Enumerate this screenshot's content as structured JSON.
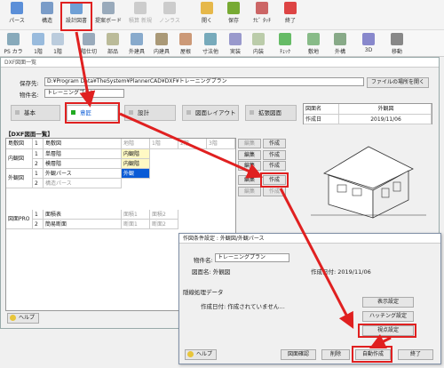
{
  "toolbar1": [
    "パース",
    "構造",
    "設計図書",
    "提案ボード",
    "積算 新規",
    "ノンラス",
    "開く",
    "保存",
    "ﾅﾋﾞ ﾀｯﾁ",
    "終了"
  ],
  "toolbar2": [
    "PS カラー",
    "1階",
    "1階",
    "階仕切",
    "部品",
    "外建具",
    "内建具",
    "屋根",
    "寸法他",
    "実装",
    "内装",
    "ﾁｪｯｸ",
    "敷地",
    "外構",
    "3D",
    "移動"
  ],
  "win": {
    "title": "DXF図面一覧",
    "folder_label": "保存先:",
    "folder_value": "D:¥Program Data¥TheSystem¥PlannerCAD¥DXF¥トレーニングプラン",
    "property_label": "物件名:",
    "property_value": "トレーニングプラン",
    "open_folder_btn": "ファイルの場所を開く",
    "tabs": [
      "基本",
      "意匠",
      "設計",
      "図面レイアウト",
      "拡張図面"
    ],
    "info": {
      "drawing_name_label": "図面名",
      "drawing_name": "外観図",
      "created_label": "作成日",
      "created": "2019/11/06"
    },
    "list_header": "【DXF図面一覧】",
    "row_groups": [
      "島敷図",
      "内観図",
      "外観図",
      "図面PRO"
    ],
    "rows": [
      {
        "no": "1",
        "name": "島敷図",
        "col1": "地階",
        "col2": "1階",
        "col3": "2階",
        "col4": "3階"
      },
      {
        "no": "1",
        "name": "単層階",
        "col1": "内観階"
      },
      {
        "no": "2",
        "name": "模層階",
        "col1": "内観階"
      },
      {
        "no": "1",
        "name": "外観パース",
        "col1": "外観"
      },
      {
        "no": "2",
        "name": "構造パース"
      },
      {
        "no": "1",
        "name": "面積表",
        "col1": "面積1",
        "col2": "面積2"
      },
      {
        "no": "2",
        "name": "簡易断面",
        "col1": "断面1",
        "col2": "断面2"
      }
    ],
    "edit_btn": "編集",
    "make_btn": "作成",
    "help": "ヘルプ"
  },
  "dialog": {
    "title": "作図条件設定 : 外観図/外観パース",
    "property_label": "物件名:",
    "property_value": "トレーニングプラン",
    "drawing_label": "図面名: 外観図",
    "created_label": "作成日付: 2019/11/06",
    "section": "隠線処理データ",
    "made_label": "作成日付: 作成されていません…",
    "btn_display": "表示設定",
    "btn_hatch": "ハッチング設定",
    "btn_view": "視点設定",
    "help": "ヘルプ",
    "btn_confirm": "図面確認",
    "btn_delete": "削除",
    "btn_auto": "自動作成",
    "btn_close": "終了"
  },
  "colors": {
    "accent": "#0a5bd6",
    "annotation": "#e02020"
  }
}
